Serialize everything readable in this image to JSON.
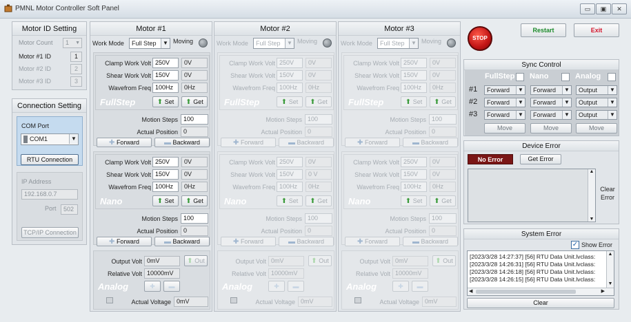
{
  "window": {
    "title": "PMNL Motor Controller Soft Panel",
    "btn_min": "▭",
    "btn_max": "▣",
    "btn_close": "✕"
  },
  "motor_id": {
    "title": "Motor ID Setting",
    "count_label": "Motor Count",
    "count_value": "1",
    "ids": [
      {
        "label": "Motor #1 ID",
        "value": "1"
      },
      {
        "label": "Motor #2 ID",
        "value": "2"
      },
      {
        "label": "Motor #3 ID",
        "value": "3"
      }
    ]
  },
  "connection": {
    "title": "Connection Setting",
    "com_label": "COM Port",
    "com_value": "COM1",
    "rtu_button": "RTU Connection",
    "ip_label": "IP Address",
    "ip_value": "192.168.0.7",
    "port_label": "Port",
    "port_value": "502",
    "tcp_button": "TCP/IP Connection"
  },
  "motors": [
    {
      "title": "Motor #1",
      "work_mode_label": "Work Mode",
      "work_mode": "Full Step",
      "moving_label": "Moving",
      "fullstep": {
        "clamp_label": "Clamp Work Volt",
        "clamp_set": "250V",
        "clamp_act": "0V",
        "shear_label": "Shear Work Volt",
        "shear_set": "150V",
        "shear_act": "0V",
        "freq_label": "Wavefrom Freq",
        "freq_set": "100Hz",
        "freq_act": "0Hz",
        "ghost": "FullStep",
        "set": "Set",
        "get": "Get",
        "steps_label": "Motion Steps",
        "steps": "100",
        "pos_label": "Actual Position",
        "pos": "0",
        "forward": "Forward",
        "backward": "Backward"
      },
      "nano": {
        "clamp_label": "Clamp Work Volt",
        "clamp_set": "250V",
        "clamp_act": "0V",
        "shear_label": "Shear Work Volt",
        "shear_set": "150V",
        "shear_act": "0V",
        "freq_label": "Wavefrom Freq",
        "freq_set": "100Hz",
        "freq_act": "0Hz",
        "ghost": "Nano",
        "set": "Set",
        "get": "Get",
        "steps_label": "Motion Steps",
        "steps": "100",
        "pos_label": "Actual Position",
        "pos": "0",
        "forward": "Forward",
        "backward": "Backward"
      },
      "analog": {
        "out_label": "Output Volt",
        "out": "0mV",
        "out_btn": "Out",
        "rel_label": "Relative Volt",
        "rel": "10000mV",
        "ghost": "Analog",
        "act_label": "Actual Voltage",
        "act": "0mV"
      }
    },
    {
      "title": "Motor #2",
      "work_mode_label": "Work Mode",
      "work_mode": "Full Step",
      "moving_label": "Moving",
      "fullstep": {
        "clamp_label": "Clamp Work Volt",
        "clamp_set": "250V",
        "clamp_act": "0V",
        "shear_label": "Shear Work Volt",
        "shear_set": "150V",
        "shear_act": "0V",
        "freq_label": "Wavefrom Freq",
        "freq_set": "100Hz",
        "freq_act": "0Hz",
        "ghost": "FullStep",
        "set": "Set",
        "get": "Get",
        "steps_label": "Motion Steps",
        "steps": "100",
        "pos_label": "Actual Position",
        "pos": "0",
        "forward": "Forward",
        "backward": "Backward"
      },
      "nano": {
        "clamp_label": "Clamp Work Volt",
        "clamp_set": "250V",
        "clamp_act": "0V",
        "shear_label": "Shear Work Volt",
        "shear_set": "150V",
        "shear_act": "0 V",
        "freq_label": "Wavefrom Freq",
        "freq_set": "100Hz",
        "freq_act": "0Hz",
        "ghost": "Nano",
        "set": "Set",
        "get": "Get",
        "steps_label": "Motion Steps",
        "steps": "100",
        "pos_label": "Actual Position",
        "pos": "0",
        "forward": "Forward",
        "backward": "Backward"
      },
      "analog": {
        "out_label": "Output Volt",
        "out": "0mV",
        "out_btn": "Out",
        "rel_label": "Relative Volt",
        "rel": "10000mV",
        "ghost": "Analog",
        "act_label": "Actual Voltage",
        "act": "0mV"
      }
    },
    {
      "title": "Motor #3",
      "work_mode_label": "Work Mode",
      "work_mode": "Full Step",
      "moving_label": "Moving",
      "fullstep": {
        "clamp_label": "Clamp Work Volt",
        "clamp_set": "250V",
        "clamp_act": "0V",
        "shear_label": "Shear Work Volt",
        "shear_set": "150V",
        "shear_act": "0V",
        "freq_label": "Wavefrom Freq",
        "freq_set": "100Hz",
        "freq_act": "0Hz",
        "ghost": "FullStep",
        "set": "Set",
        "get": "Get",
        "steps_label": "Motion Steps",
        "steps": "100",
        "pos_label": "Actual Position",
        "pos": "0",
        "forward": "Forward",
        "backward": "Backward"
      },
      "nano": {
        "clamp_label": "Clamp Work Volt",
        "clamp_set": "250V",
        "clamp_act": "0V",
        "shear_label": "Shear Work Volt",
        "shear_set": "150V",
        "shear_act": "0V",
        "freq_label": "Wavefrom Freq",
        "freq_set": "100Hz",
        "freq_act": "0Hz",
        "ghost": "Nano",
        "set": "Set",
        "get": "Get",
        "steps_label": "Motion Steps",
        "steps": "100",
        "pos_label": "Actual Position",
        "pos": "0",
        "forward": "Forward",
        "backward": "Backward"
      },
      "analog": {
        "out_label": "Output Volt",
        "out": "0mV",
        "out_btn": "Out",
        "rel_label": "Relative Volt",
        "rel": "10000mV",
        "ghost": "Analog",
        "act_label": "Actual Voltage",
        "act": "0mV"
      }
    }
  ],
  "top_buttons": {
    "stop": "STOP",
    "restart": "Restart",
    "exit": "Exit"
  },
  "sync": {
    "title": "Sync Control",
    "headers": [
      "FullStep",
      "Nano",
      "Analog"
    ],
    "rows": [
      {
        "label": "#1",
        "values": [
          "Forward",
          "Forward",
          "Output"
        ]
      },
      {
        "label": "#2",
        "values": [
          "Forward",
          "Forward",
          "Output"
        ]
      },
      {
        "label": "#3",
        "values": [
          "Forward",
          "Forward",
          "Output"
        ]
      }
    ],
    "move": "Move"
  },
  "device_error": {
    "title": "Device Error",
    "status": "No Error",
    "get_button": "Get Error",
    "clear_button": "Clear Error"
  },
  "system_error": {
    "title": "System Error",
    "show_label": "Show Error",
    "logs": [
      "[2023/3/28 14:27:37] [56] RTU Data Unit.lvclass:",
      "[2023/3/28 14:26:31] [56] RTU Data Unit.lvclass:",
      "[2023/3/28 14:26:18] [56] RTU Data Unit.lvclass:",
      "[2023/3/28 14:26:15] [56] RTU Data Unit.lvclass:"
    ],
    "clear_button": "Clear"
  },
  "colors": {
    "stop_red": "#d21f1f",
    "restart_green": "#1b8a2a",
    "exit_red": "#d4152b",
    "no_error_bg": "#7a1616"
  }
}
